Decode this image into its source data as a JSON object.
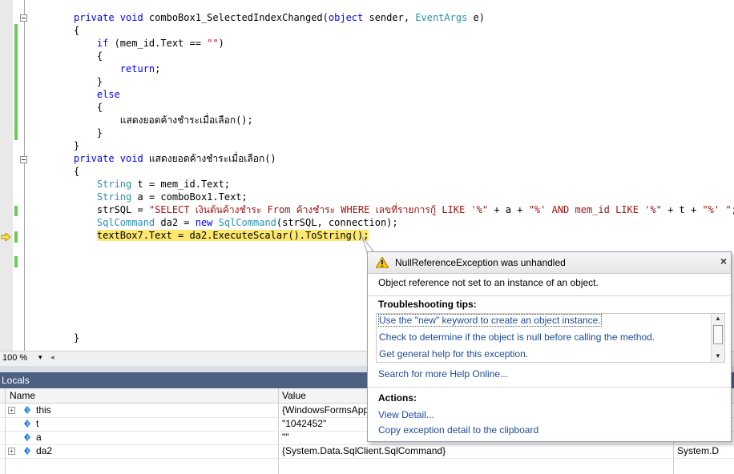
{
  "editor": {
    "zoom": "100 %",
    "lines": [
      [
        [
          "kw",
          "private void "
        ],
        [
          "",
          "comboBox1_SelectedIndexChanged("
        ],
        [
          "kw",
          "object"
        ],
        [
          "",
          " sender, "
        ],
        [
          "ty",
          "EventArgs"
        ],
        [
          "",
          " e)"
        ]
      ],
      [
        [
          "",
          "{"
        ]
      ],
      [
        [
          "",
          "    "
        ],
        [
          "kw",
          "if"
        ],
        [
          "",
          " (mem_id.Text == "
        ],
        [
          "st",
          "\"\""
        ],
        [
          "",
          ")"
        ]
      ],
      [
        [
          "",
          "    {"
        ]
      ],
      [
        [
          "",
          "        "
        ],
        [
          "kw",
          "return"
        ],
        [
          "",
          ";"
        ]
      ],
      [
        [
          "",
          "    }"
        ]
      ],
      [
        [
          "",
          "    "
        ],
        [
          "kw",
          "else"
        ]
      ],
      [
        [
          "",
          "    {"
        ]
      ],
      [
        [
          "",
          "        แสดงยอดค้างชำระเมื่อเลือก();"
        ]
      ],
      [
        [
          "",
          "    }"
        ]
      ],
      [
        [
          "",
          "}"
        ]
      ],
      [
        [
          "kw",
          "private void "
        ],
        [
          "",
          "แสดงยอดค้างชำระเมื่อเลือก()"
        ]
      ],
      [
        [
          "",
          "{"
        ]
      ],
      [
        [
          "",
          "    "
        ],
        [
          "ty",
          "String"
        ],
        [
          "",
          " t = mem_id.Text;"
        ]
      ],
      [
        [
          "",
          "    "
        ],
        [
          "ty",
          "String"
        ],
        [
          "",
          " a = comboBox1.Text;"
        ]
      ],
      [
        [
          "",
          "    strSQL = "
        ],
        [
          "st",
          "\"SELECT เงินต้นค้างชำระ From ค้างชำระ WHERE เลขที่รายการกู้ LIKE '%\""
        ],
        [
          "",
          " + a + "
        ],
        [
          "st",
          "\"%' AND mem_id LIKE '%\""
        ],
        [
          "",
          " + t + "
        ],
        [
          "st",
          "\"%' \""
        ],
        [
          "",
          ";"
        ]
      ],
      [
        [
          "",
          "    "
        ],
        [
          "ty",
          "SqlCommand"
        ],
        [
          "",
          " da2 = "
        ],
        [
          "kw",
          "new"
        ],
        [
          "",
          " "
        ],
        [
          "ty",
          "SqlCommand"
        ],
        [
          "",
          "(strSQL, connection);"
        ]
      ],
      [
        [
          "",
          "    "
        ],
        [
          "hl",
          "textBox7.Text = da2.ExecuteScalar().ToString();"
        ]
      ],
      [
        [
          "",
          ""
        ]
      ],
      [
        [
          "",
          ""
        ]
      ],
      [
        [
          "",
          ""
        ]
      ],
      [
        [
          "",
          ""
        ]
      ],
      [
        [
          "",
          ""
        ]
      ],
      [
        [
          "",
          ""
        ]
      ],
      [
        [
          "",
          ""
        ]
      ],
      [
        [
          "",
          "}"
        ]
      ]
    ]
  },
  "locals": {
    "title": "Locals",
    "headers": {
      "name": "Name",
      "value": "Value"
    },
    "rows": [
      {
        "name": "this",
        "value": "{WindowsFormsApp",
        "type": "",
        "expand": "+"
      },
      {
        "name": "t",
        "value": "\"1042452\"",
        "type": "",
        "expand": ""
      },
      {
        "name": "a",
        "value": "\"\"",
        "type": "",
        "expand": ""
      },
      {
        "name": "da2",
        "value": "{System.Data.SqlClient.SqlCommand}",
        "type": "System.D",
        "expand": "+"
      }
    ]
  },
  "exception": {
    "title": "NullReferenceException was unhandled",
    "close": "×",
    "message": "Object reference not set to an instance of an object.",
    "tips_label": "Troubleshooting tips:",
    "tips": [
      "Use the \"new\" keyword to create an object instance.",
      "Check to determine if the object is null before calling the method.",
      "Get general help for this exception."
    ],
    "search_link": "Search for more Help Online...",
    "actions_label": "Actions:",
    "actions": [
      "View Detail...",
      "Copy exception detail to the clipboard"
    ]
  },
  "colors": {
    "keyword": "#0000ff",
    "type": "#2b91af",
    "string": "#a31515",
    "highlight": "#fde76e",
    "locals_title": "#4d6082",
    "link": "#1d4b9c"
  },
  "icons": {
    "current_line": "yellow-arrow-icon",
    "warning": "warning-icon",
    "close": "close-icon",
    "variable": "variable-icon"
  }
}
